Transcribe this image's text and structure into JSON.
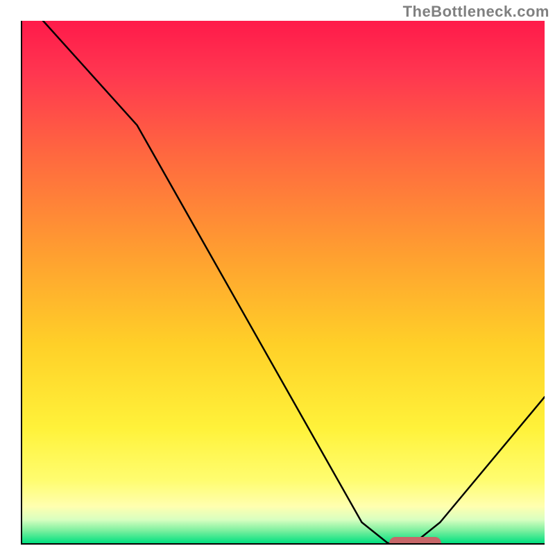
{
  "watermark": "TheBottleneck.com",
  "chart_data": {
    "type": "line",
    "title": "",
    "xlabel": "",
    "ylabel": "",
    "xlim": [
      0,
      100
    ],
    "ylim": [
      0,
      100
    ],
    "x": [
      0,
      4,
      22,
      65,
      70,
      75,
      80,
      100
    ],
    "values": [
      104,
      100,
      80,
      4,
      0,
      0,
      4,
      28
    ],
    "gradient_stops": [
      {
        "pos": 0.0,
        "color": "#ff1a4a"
      },
      {
        "pos": 0.1,
        "color": "#ff3650"
      },
      {
        "pos": 0.25,
        "color": "#ff6640"
      },
      {
        "pos": 0.45,
        "color": "#ffa030"
      },
      {
        "pos": 0.62,
        "color": "#ffd028"
      },
      {
        "pos": 0.78,
        "color": "#fff23a"
      },
      {
        "pos": 0.88,
        "color": "#fffd70"
      },
      {
        "pos": 0.93,
        "color": "#ffffb0"
      },
      {
        "pos": 0.955,
        "color": "#d8ffc0"
      },
      {
        "pos": 0.975,
        "color": "#80f0a0"
      },
      {
        "pos": 1.0,
        "color": "#00e080"
      }
    ],
    "optimal_zone": {
      "start": 70,
      "end": 80
    }
  }
}
